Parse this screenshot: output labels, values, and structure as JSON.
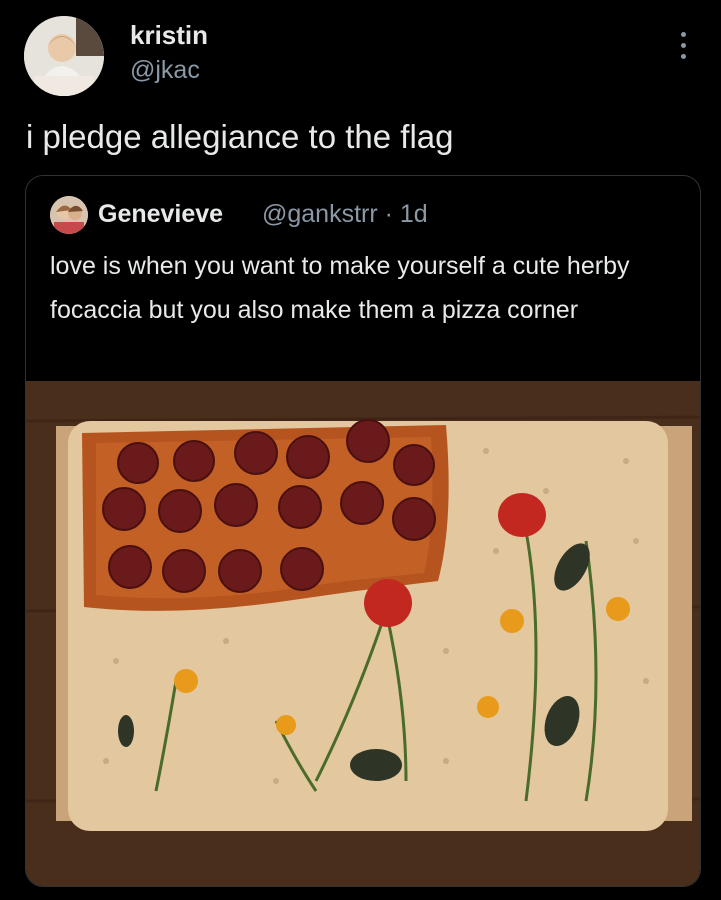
{
  "post": {
    "display_name": "kristin",
    "handle": "@jkac",
    "text": "i pledge allegiance to the flag",
    "avatar_icon": "profile-photo-baby",
    "more_icon": "more-options-icon"
  },
  "quote": {
    "display_name": "Genevieve",
    "handle_time": "@gankstrr · 1d",
    "text": "love is when you want to make yourself a cute herby focaccia but you also make them a pizza corner",
    "image_icon": "focaccia-photo"
  },
  "colors": {
    "background": "#000000",
    "text_primary": "#e7e9ea",
    "text_secondary": "#8b98a5",
    "border": "#2f3336"
  }
}
